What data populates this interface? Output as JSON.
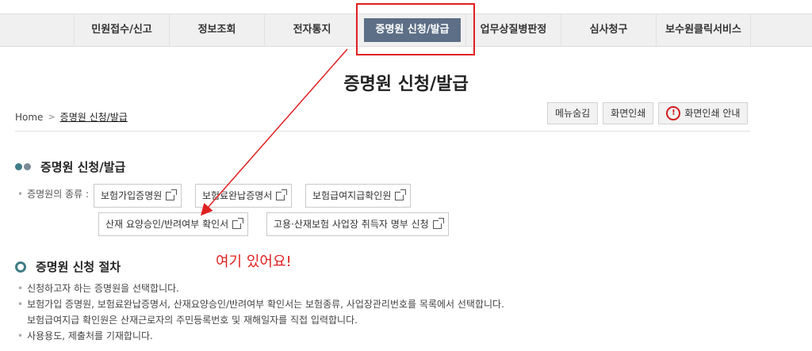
{
  "nav": {
    "items": [
      "민원접수/신고",
      "정보조회",
      "전자통지",
      "증명원 신청/발급",
      "업무상질병판정",
      "심사청구",
      "보수원클릭서비스"
    ],
    "active_index": 3,
    "active_color": "#5c6f86"
  },
  "page_title": "증명원 신청/발급",
  "breadcrumb": {
    "home": "Home",
    "current": "증명원 신청/발급"
  },
  "utility_buttons": {
    "hide_menu": "메뉴숨김",
    "print": "화면인쇄",
    "print_guide": "화면인쇄 안내"
  },
  "section1": {
    "title": "증명원 신청/발급",
    "kind_label": "증명원의 종류 :",
    "buttons": [
      "보험가입증명원",
      "보험료완납증명서",
      "보험급여지급확인원",
      "산재 요양승인/반려여부 확인서",
      "고용·산재보험 사업장 취득자 명부 신청"
    ]
  },
  "annotation": {
    "text": "여기 있어요!",
    "color": "#e02020"
  },
  "section2": {
    "title": "증명원 신청 절차",
    "steps": [
      "신청하고자 하는 증명원을 선택합니다.",
      "보험가입 증명원, 보험료완납증명서, 산재요양승인/반려여부 확인서는 보험종류, 사업장관리번호를 목록에서 선택합니다.",
      "보험급여지급 확인원은 산재근로자의 주민등록번호 및 재해일자를 직접 입력합니다.",
      "사용용도, 제출처를 기재합니다."
    ]
  }
}
